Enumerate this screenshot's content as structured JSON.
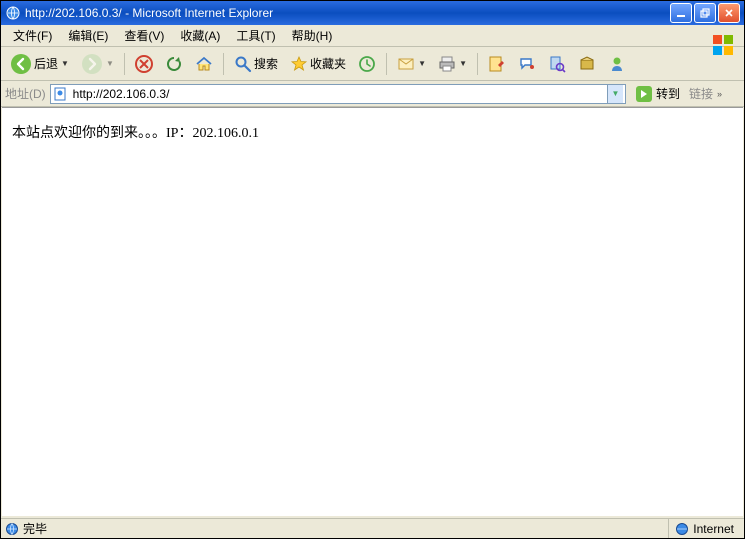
{
  "title": "http://202.106.0.3/ - Microsoft Internet Explorer",
  "menu": {
    "file": "文件(F)",
    "edit": "编辑(E)",
    "view": "查看(V)",
    "favorites": "收藏(A)",
    "tools": "工具(T)",
    "help": "帮助(H)"
  },
  "toolbar": {
    "back": "后退",
    "search": "搜索",
    "favorites": "收藏夹"
  },
  "address": {
    "label": "地址(D)",
    "url": "http://202.106.0.3/",
    "go": "转到",
    "links": "链接"
  },
  "page": {
    "body": "本站点欢迎你的到来。。。IP：202.106.0.1"
  },
  "status": {
    "done": "完毕",
    "zone": "Internet"
  }
}
